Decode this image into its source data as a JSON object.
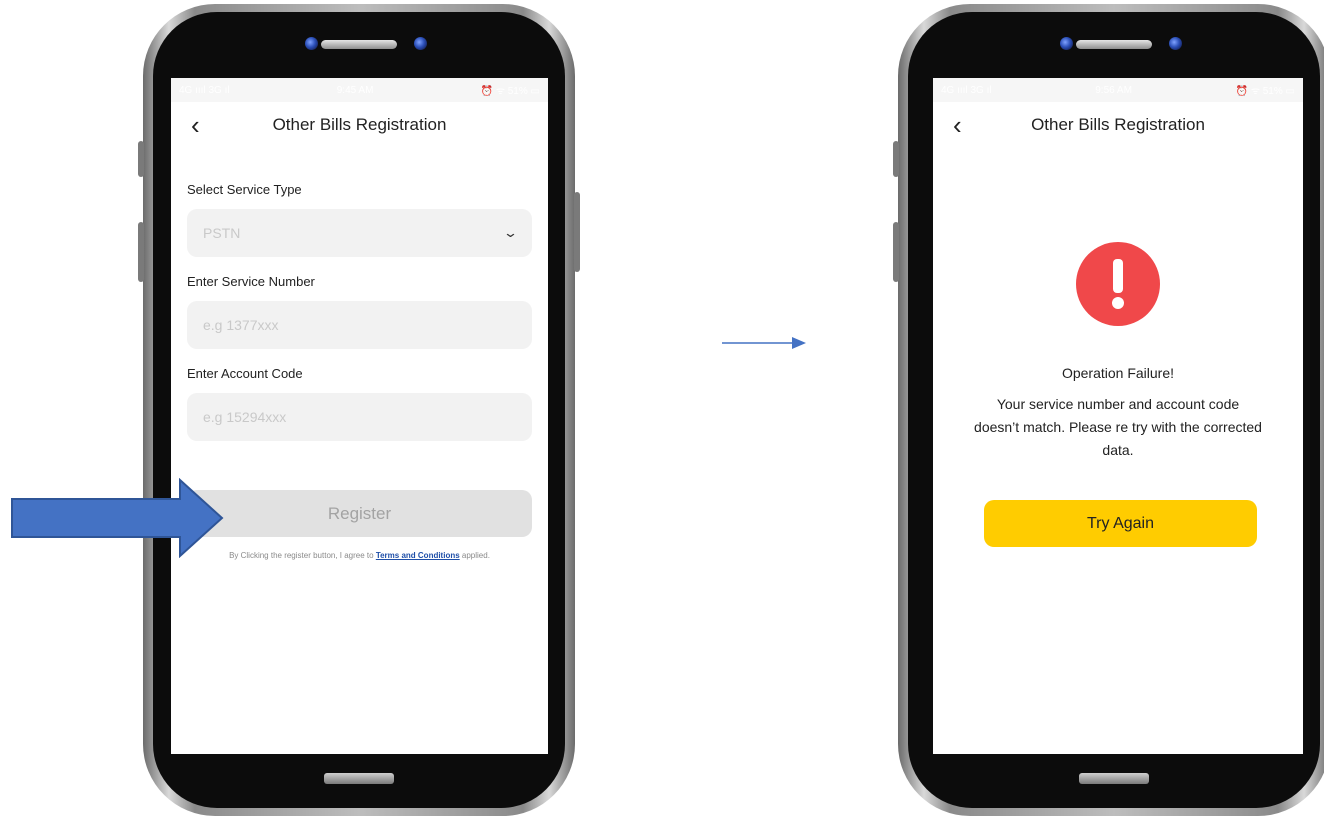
{
  "left_screen": {
    "status_bar": {
      "left": "4G ıııl 3G ıl",
      "time": "9:45 AM",
      "right": "⏰ ᯤ 51% ▭"
    },
    "header": {
      "back_icon": "‹",
      "title": "Other Bills Registration"
    },
    "service_type": {
      "label": "Select Service Type",
      "value": "PSTN",
      "chevron": "⌄"
    },
    "service_number": {
      "label": "Enter Service Number",
      "placeholder": "e.g 1377xxx"
    },
    "account_code": {
      "label": "Enter Account Code",
      "placeholder": "e.g 15294xxx"
    },
    "register_button": "Register",
    "terms": {
      "prefix": "By Clicking the register button, I agree to ",
      "link": "Terms and Conditions",
      "suffix": " applied."
    }
  },
  "right_screen": {
    "status_bar": {
      "left": "4G ıııl 3G ıl",
      "time": "9:56 AM",
      "right": "⏰ ᯤ 51% ▭"
    },
    "header": {
      "back_icon": "‹",
      "title": "Other Bills Registration"
    },
    "alert_icon": "!",
    "title": "Operation Failure!",
    "message": "Your service number and account code doesn’t match. Please re try with the corrected data.",
    "try_again_button": "Try Again"
  },
  "colors": {
    "alert_red": "#f0484a",
    "try_again_yellow": "#ffcc00",
    "arrow_blue": "#4472c4",
    "link_blue": "#1f4fa8"
  },
  "icons": {
    "pointer_arrow": "right-arrow-icon",
    "flow_arrow": "arrow-right-icon",
    "alert": "exclamation-icon",
    "back": "chevron-left-icon",
    "dropdown": "chevron-down-icon"
  }
}
